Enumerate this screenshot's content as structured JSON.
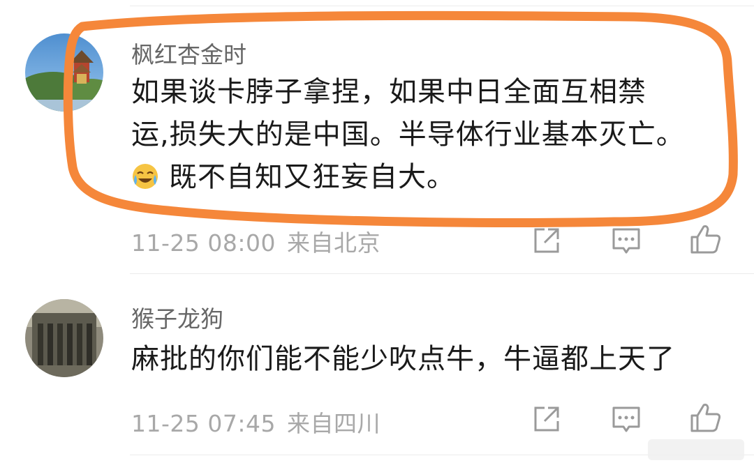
{
  "comments": [
    {
      "username": "枫红杏金时",
      "content_line1": "如果谈卡脖子拿捏，如果中日全面互相禁",
      "content_line2": "运,损失大的是中国。半导体行业基本灭亡。",
      "content_line3": "既不自知又狂妄自大。",
      "emoji_icon": "crying-laughing-emoji",
      "timestamp": "11-25 08:00",
      "location": "来自北京"
    },
    {
      "username": "猴子龙狗",
      "content": "麻批的你们能不能少吹点牛，牛逼都上天了",
      "timestamp": "11-25 07:45",
      "location": "来自四川"
    }
  ],
  "colors": {
    "highlight": "#f5873a",
    "username": "#666666",
    "meta": "#a8a8a8",
    "text": "#1a1a1a",
    "icon": "#9a9a9a"
  },
  "icons": [
    "share-icon",
    "reply-icon",
    "like-icon"
  ]
}
